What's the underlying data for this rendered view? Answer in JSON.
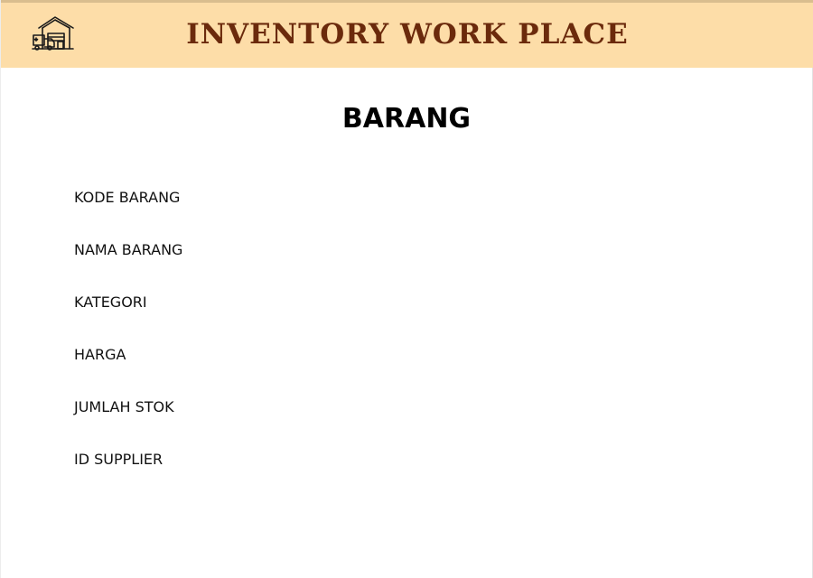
{
  "header": {
    "logo_icon": "warehouse-icon",
    "title": "INVENTORY WORK PLACE",
    "background_color": "#fddda8",
    "title_color": "#6b2a0c"
  },
  "form": {
    "title": "BARANG",
    "fields": [
      {
        "label": "KODE BARANG"
      },
      {
        "label": "NAMA BARANG"
      },
      {
        "label": "KATEGORI"
      },
      {
        "label": "HARGA"
      },
      {
        "label": "JUMLAH STOK"
      },
      {
        "label": "ID SUPPLIER"
      }
    ]
  }
}
